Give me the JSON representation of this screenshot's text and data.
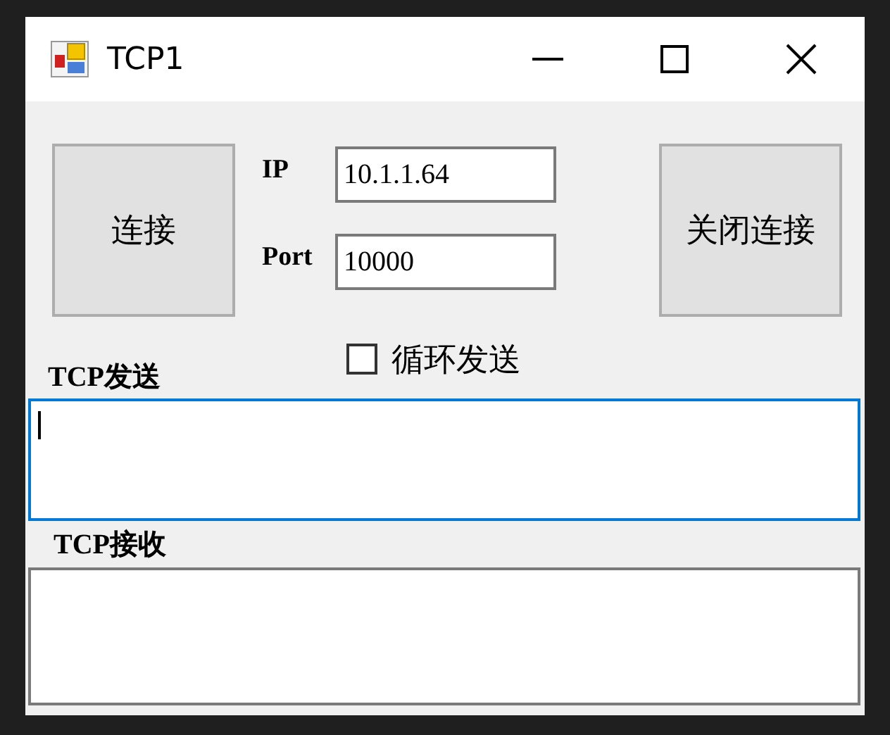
{
  "window": {
    "title": "TCP1"
  },
  "connect_button": {
    "label": "连接"
  },
  "ip": {
    "label": "IP",
    "value": "10.1.1.64"
  },
  "port": {
    "label": "Port",
    "value": "10000"
  },
  "close_button": {
    "label": "关闭连接"
  },
  "loop_send": {
    "label": "循环发送",
    "checked": false
  },
  "send": {
    "label": "TCP发送",
    "focused": true
  },
  "receive": {
    "label": "TCP接收"
  }
}
